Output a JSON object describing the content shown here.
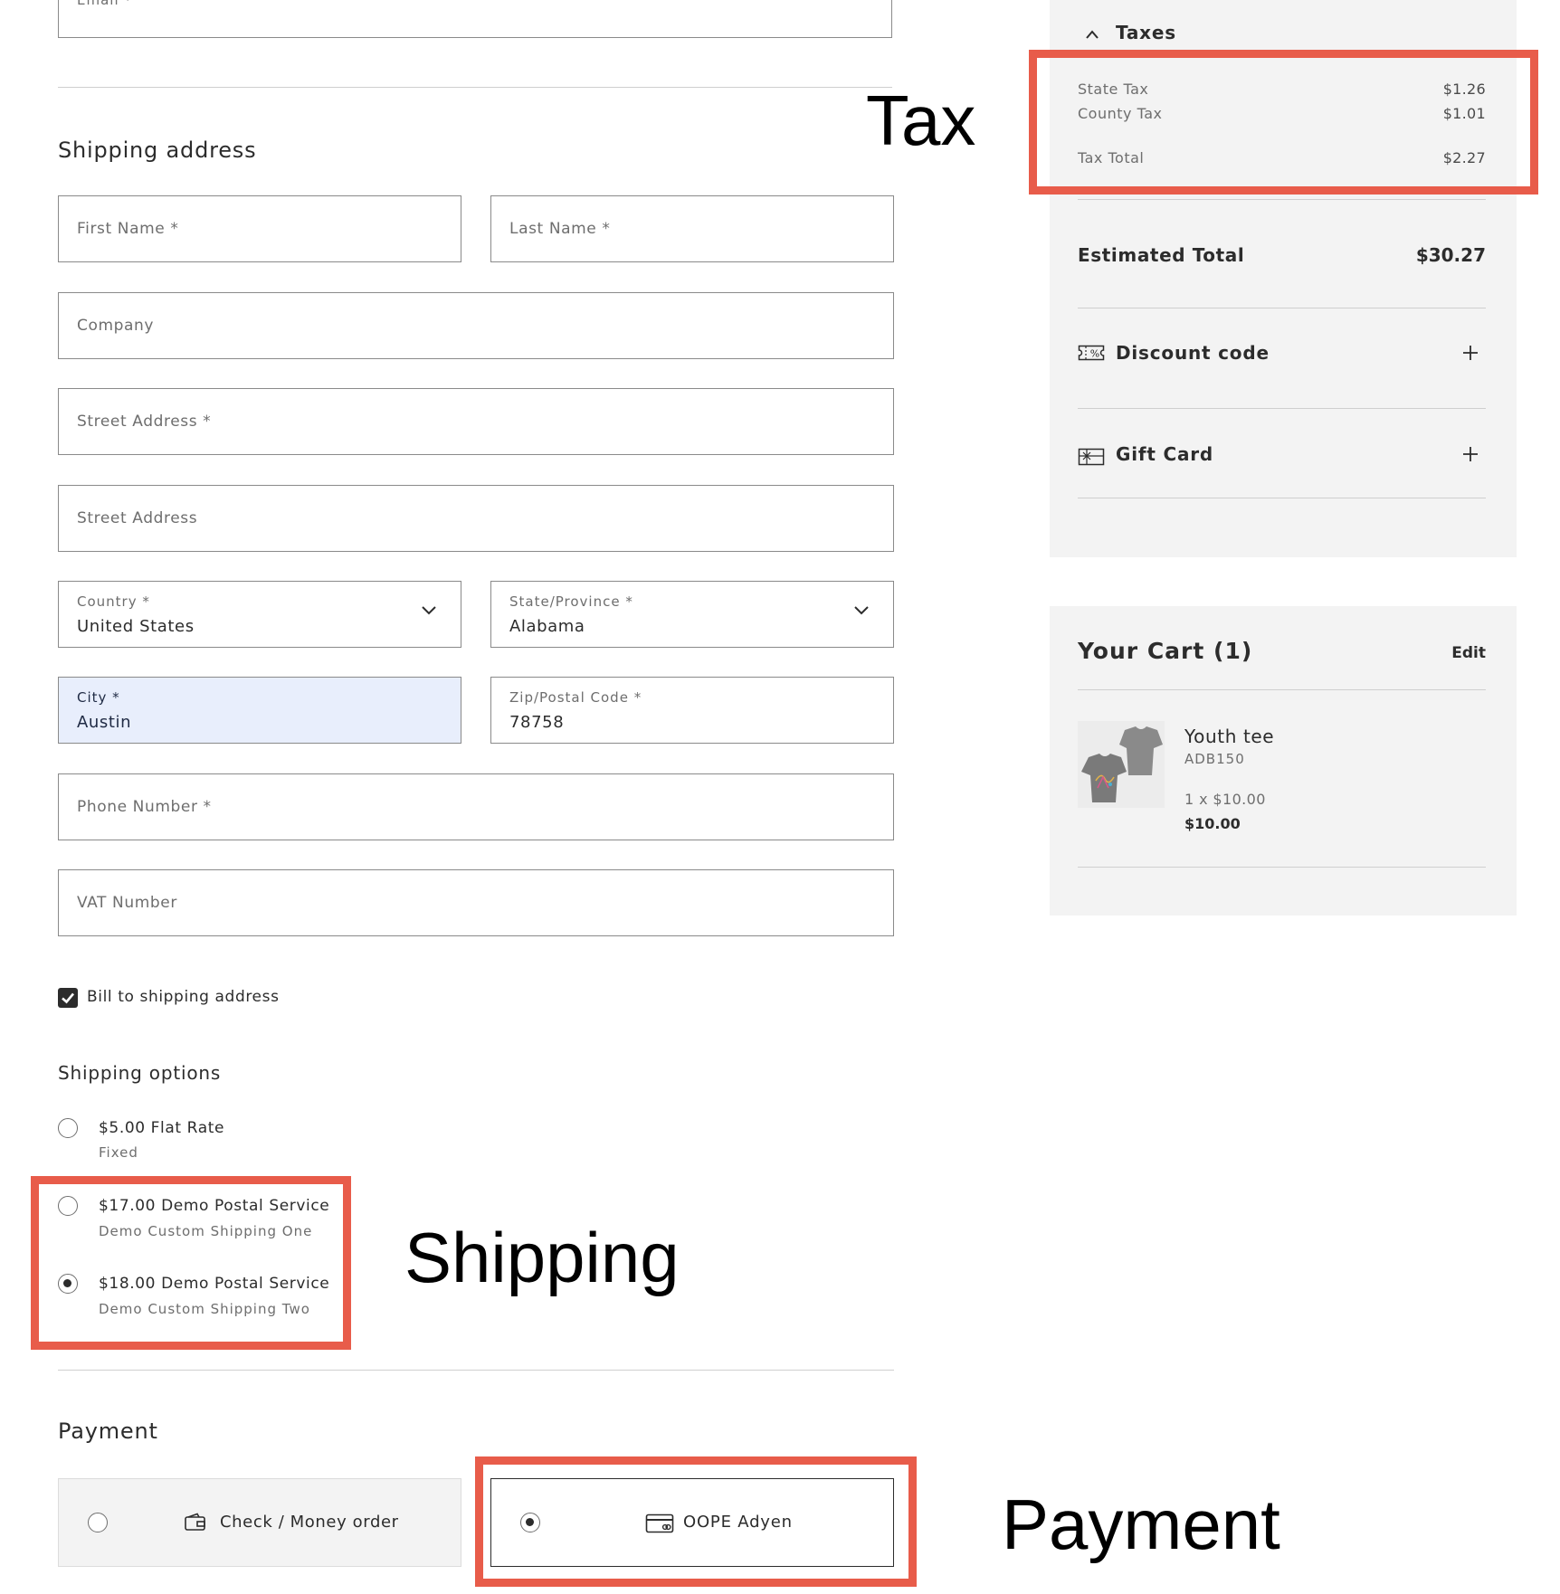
{
  "form": {
    "email_placeholder": "Email *",
    "shipping_title": "Shipping address",
    "first_name_placeholder": "First Name *",
    "last_name_placeholder": "Last Name *",
    "company_placeholder": "Company",
    "street1_placeholder": "Street Address *",
    "street2_placeholder": "Street Address",
    "country": {
      "label": "Country *",
      "value": "United States"
    },
    "state": {
      "label": "State/Province *",
      "value": "Alabama"
    },
    "city": {
      "label": "City *",
      "value": "Austin"
    },
    "zip": {
      "label": "Zip/Postal Code *",
      "value": "78758"
    },
    "phone_placeholder": "Phone Number *",
    "vat_placeholder": "VAT Number",
    "bill_to_shipping": {
      "label": "Bill to shipping address",
      "checked": true
    }
  },
  "shipping": {
    "title": "Shipping options",
    "options": [
      {
        "title": "$5.00 Flat Rate",
        "subtitle": "Fixed",
        "selected": false
      },
      {
        "title": "$17.00 Demo Postal Service",
        "subtitle": "Demo Custom Shipping One",
        "selected": false
      },
      {
        "title": "$18.00 Demo Postal Service",
        "subtitle": "Demo Custom Shipping Two",
        "selected": true
      }
    ]
  },
  "payment": {
    "title": "Payment",
    "options": [
      {
        "label": "Check / Money order",
        "icon": "wallet-icon",
        "selected": false
      },
      {
        "label": "OOPE Adyen",
        "icon": "credit-card-icon",
        "selected": true
      }
    ]
  },
  "summary": {
    "taxes_label": "Taxes",
    "state_tax": {
      "label": "State Tax",
      "value": "$1.26"
    },
    "county_tax": {
      "label": "County Tax",
      "value": "$1.01"
    },
    "tax_total": {
      "label": "Tax Total",
      "value": "$2.27"
    },
    "estimated_total": {
      "label": "Estimated Total",
      "value": "$30.27"
    },
    "discount_label": "Discount code",
    "gift_card_label": "Gift Card"
  },
  "cart": {
    "title": "Your Cart (1)",
    "edit_label": "Edit",
    "items": [
      {
        "name": "Youth tee",
        "sku": "ADB150",
        "qty_price": "1 x $10.00",
        "line_total": "$10.00"
      }
    ]
  },
  "annotations": {
    "tax": "Tax",
    "shipping": "Shipping",
    "payment": "Payment",
    "highlight_color": "#e85c4a"
  }
}
